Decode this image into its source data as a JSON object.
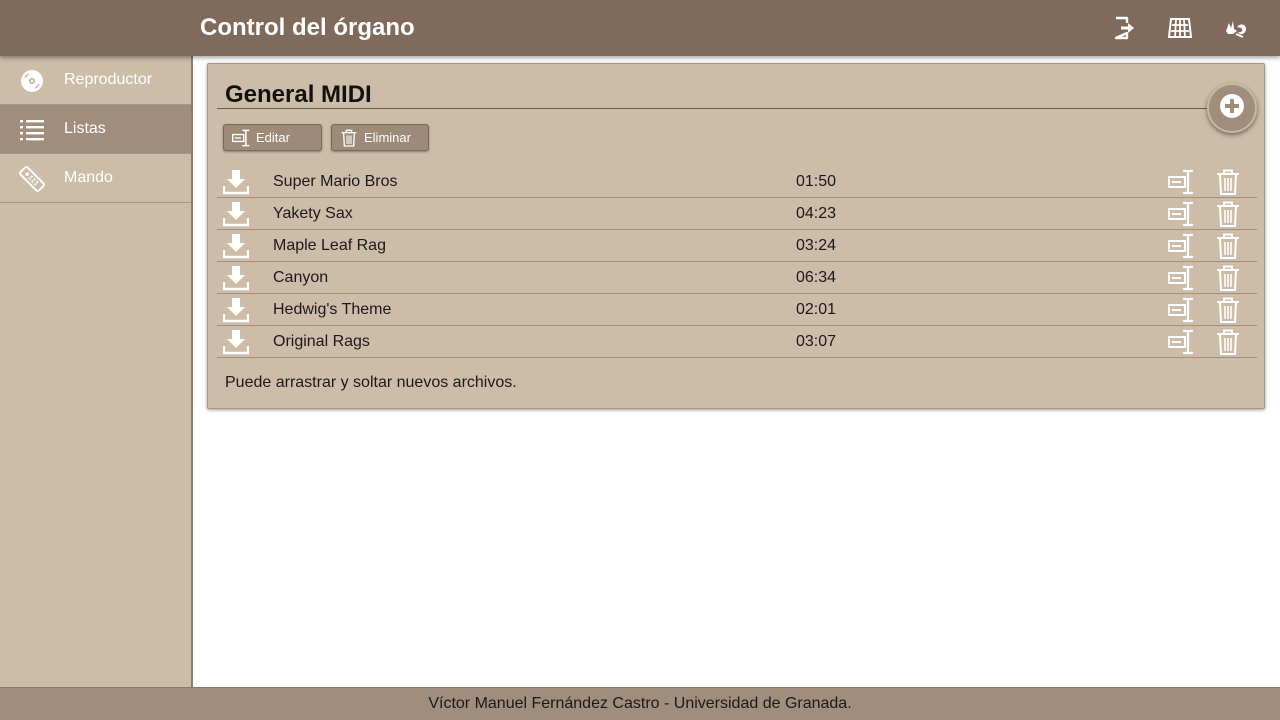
{
  "header": {
    "title": "Control del órgano",
    "icons": [
      "logout-icon",
      "keyboard-icon",
      "sign-language-icon"
    ]
  },
  "sidebar": {
    "items": [
      {
        "label": "Reproductor",
        "icon": "disc-icon",
        "active": false
      },
      {
        "label": "Listas",
        "icon": "list-icon",
        "active": true
      },
      {
        "label": "Mando",
        "icon": "remote-control-icon",
        "active": false
      }
    ]
  },
  "playlist": {
    "title": "General MIDI",
    "edit_label": "Editar",
    "delete_label": "Eliminar",
    "add_icon": "add-circle-icon",
    "songs": [
      {
        "name": "Super Mario Bros",
        "duration": "01:50"
      },
      {
        "name": "Yakety Sax",
        "duration": "04:23"
      },
      {
        "name": "Maple Leaf Rag",
        "duration": "03:24"
      },
      {
        "name": "Canyon",
        "duration": "06:34"
      },
      {
        "name": "Hedwig's Theme",
        "duration": "02:01"
      },
      {
        "name": "Original Rags",
        "duration": "03:07"
      }
    ],
    "hint": "Puede arrastrar y soltar nuevos archivos."
  },
  "footer": {
    "text": "Víctor Manuel Fernández Castro - Universidad de Granada."
  },
  "colors": {
    "topbar": "#7f6a5c",
    "sidebar": "#cdbca7",
    "sidebar_active": "#a08d7c",
    "card": "#cdbca7",
    "footer": "#a08d7c"
  }
}
